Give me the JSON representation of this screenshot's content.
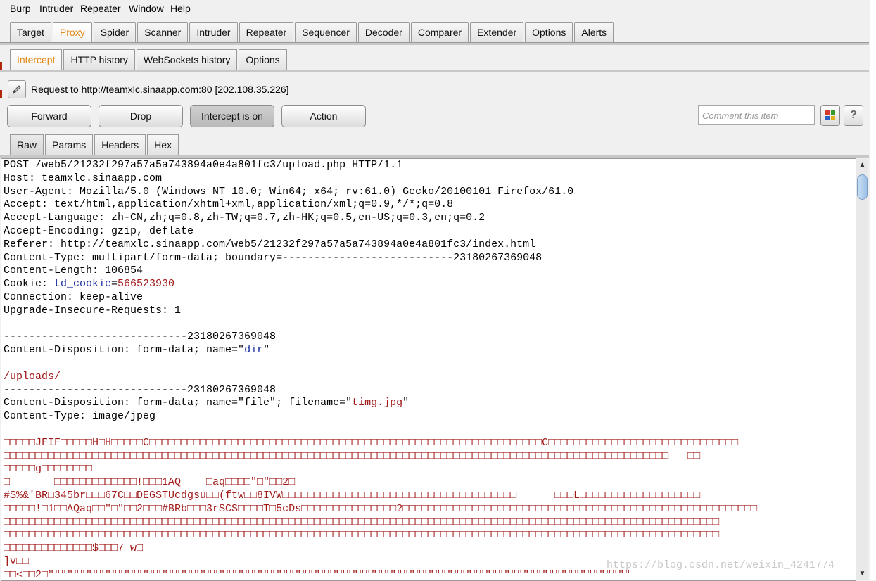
{
  "menu": [
    "Burp",
    "Intruder",
    "Repeater",
    "Window",
    "Help"
  ],
  "main_tabs": [
    "Target",
    "Proxy",
    "Spider",
    "Scanner",
    "Intruder",
    "Repeater",
    "Sequencer",
    "Decoder",
    "Comparer",
    "Extender",
    "Options",
    "Alerts"
  ],
  "active_main_tab": "Proxy",
  "proxy_tabs": [
    "Intercept",
    "HTTP history",
    "WebSockets history",
    "Options"
  ],
  "active_proxy_tab": "Intercept",
  "request_line": "Request to http://teamxlc.sinaapp.com:80  [202.108.35.226]",
  "buttons": {
    "forward": "Forward",
    "drop": "Drop",
    "intercept": "Intercept is on",
    "action": "Action"
  },
  "comment_placeholder": "Comment this item",
  "help_label": "?",
  "view_tabs": [
    "Raw",
    "Params",
    "Headers",
    "Hex"
  ],
  "active_view_tab": "Raw",
  "request_lines": [
    [
      {
        "t": "POST /web5/21232f297a57a5a743894a0e4a801fc3/upload.php HTTP/1.1",
        "c": ""
      }
    ],
    [
      {
        "t": "Host: teamxlc.sinaapp.com",
        "c": ""
      }
    ],
    [
      {
        "t": "User-Agent: Mozilla/5.0 (Windows NT 10.0; Win64; x64; rv:61.0) Gecko/20100101 Firefox/61.0",
        "c": ""
      }
    ],
    [
      {
        "t": "Accept: text/html,application/xhtml+xml,application/xml;q=0.9,*/*;q=0.8",
        "c": ""
      }
    ],
    [
      {
        "t": "Accept-Language: zh-CN,zh;q=0.8,zh-TW;q=0.7,zh-HK;q=0.5,en-US;q=0.3,en;q=0.2",
        "c": ""
      }
    ],
    [
      {
        "t": "Accept-Encoding: gzip, deflate",
        "c": ""
      }
    ],
    [
      {
        "t": "Referer: http://teamxlc.sinaapp.com/web5/21232f297a57a5a743894a0e4a801fc3/index.html",
        "c": ""
      }
    ],
    [
      {
        "t": "Content-Type: multipart/form-data; boundary=---------------------------23180267369048",
        "c": ""
      }
    ],
    [
      {
        "t": "Content-Length: 106854",
        "c": ""
      }
    ],
    [
      {
        "t": "Cookie: ",
        "c": ""
      },
      {
        "t": "td_cookie",
        "c": "blue"
      },
      {
        "t": "=",
        "c": ""
      },
      {
        "t": "566523930",
        "c": "red"
      }
    ],
    [
      {
        "t": "Connection: keep-alive",
        "c": ""
      }
    ],
    [
      {
        "t": "Upgrade-Insecure-Requests: 1",
        "c": ""
      }
    ],
    [
      {
        "t": "",
        "c": ""
      }
    ],
    [
      {
        "t": "-----------------------------23180267369048",
        "c": ""
      }
    ],
    [
      {
        "t": "Content-Disposition: form-data; name=\"",
        "c": ""
      },
      {
        "t": "dir",
        "c": "blue"
      },
      {
        "t": "\"",
        "c": ""
      }
    ],
    [
      {
        "t": "",
        "c": ""
      }
    ],
    [
      {
        "t": "/uploads/",
        "c": "red"
      }
    ],
    [
      {
        "t": "-----------------------------23180267369048",
        "c": ""
      }
    ],
    [
      {
        "t": "Content-Disposition: form-data; name=\"file\"; filename=\"",
        "c": ""
      },
      {
        "t": "timg.jpg",
        "c": "red"
      },
      {
        "t": "\"",
        "c": ""
      }
    ],
    [
      {
        "t": "Content-Type: image/jpeg",
        "c": ""
      }
    ],
    [
      {
        "t": "",
        "c": ""
      }
    ],
    [
      {
        "t": "□□□□□JFIF□□□□□H□H□□□□□C□□□□□□□□□□□□□□□□□□□□□□□□□□□□□□□□□□□□□□□□□□□□□□□□□□□□□□□□□□□□□□C□□□□□□□□□□□□□□□□□□□□□□□□□□□□□□",
        "c": "red"
      }
    ],
    [
      {
        "t": "□□□□□□□□□□□□□□□□□□□□□□□□□□□□□□□□□□□□□□□□□□□□□□□□□□□□□□□□□□□□□□□□□□□□□□□□□□□□□□□□□□□□□□□□□□□□□□□□□□□□□□□□□   □□",
        "c": "red"
      }
    ],
    [
      {
        "t": "□□□□□g□□□□□□□□",
        "c": "red"
      }
    ],
    [
      {
        "t": "□       □□□□□□□□□□□□□!□□□1AQ    □aq□□□□\"□\"□□2□",
        "c": "red"
      }
    ],
    [
      {
        "t": "#$%&'BR□345br□□□67C□□DEGSTUcdgsu□□(ftw□□8IVW□□□□□□□□□□□□□□□□□□□□□□□□□□□□□□□□□□□□□      □□□L□□□□□□□□□□□□□□□□□□□",
        "c": "red"
      }
    ],
    [
      {
        "t": "□□□□□!□1□□AQaq□□\"□\"□□2□□□#BRb□□□3r$CS□□□□T□5cDs□□□□□□□□□□□□□□□?□□□□□□□□□□□□□□□□□□□□□□□□□□□□□□□□□□□□□□□□□□□□□□□□□□□□□□□□",
        "c": "red"
      }
    ],
    [
      {
        "t": "□□□□□□□□□□□□□□□□□□□□□□□□□□□□□□□□□□□□□□□□□□□□□□□□□□□□□□□□□□□□□□□□□□□□□□□□□□□□□□□□□□□□□□□□□□□□□□□□□□□□□□□□□□□□□□□□□",
        "c": "red"
      }
    ],
    [
      {
        "t": "□□□□□□□□□□□□□□□□□□□□□□□□□□□□□□□□□□□□□□□□□□□□□□□□□□□□□□□□□□□□□□□□□□□□□□□□□□□□□□□□□□□□□□□□□□□□□□□□□□□□□□□□□□□□□□□□□",
        "c": "red"
      }
    ],
    [
      {
        "t": "□□□□□□□□□□□□□□$□□□7 w□",
        "c": "red"
      }
    ],
    [
      {
        "t": "]v□□",
        "c": "red"
      }
    ],
    [
      {
        "t": "□□<□□2□\"\"\"\"\"\"\"\"\"\"\"\"\"\"\"\"\"\"\"\"\"\"\"\"\"\"\"\"\"\"\"\"\"\"\"\"\"\"\"\"\"\"\"\"\"\"\"\"\"\"\"\"\"\"\"\"\"\"\"\"\"\"\"\"\"\"\"\"\"\"\"\"\"\"\"\"\"\"\"\"\"\"\"\"\"\"\"\"\"\"\"\"",
        "c": "red"
      }
    ]
  ],
  "watermark": "https://blog.csdn.net/weixin_4241774"
}
